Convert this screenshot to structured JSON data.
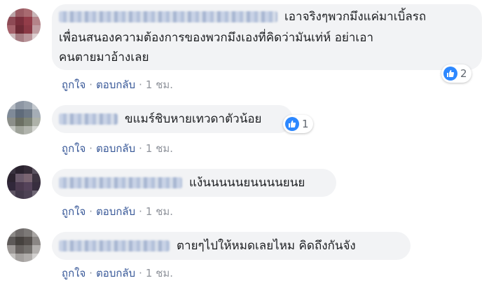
{
  "comments": [
    {
      "text_lines": [
        "เอาจริงๆพวกมึงแค่มาเบิ้ลรถ",
        "เพื่อนสนองความต้องการของพวกมึงเองที่คิดว่ามันเท่ห์ อย่าเอา",
        "คนตายมาอ้างเลย"
      ],
      "reaction_count": "2",
      "like_label": "ถูกใจ",
      "reply_label": "ตอบกลับ",
      "time": "1 ชม."
    },
    {
      "text_lines": [
        "ขแมร์ชิบหายเทวดาตัวน้อย"
      ],
      "reaction_count": "1",
      "like_label": "ถูกใจ",
      "reply_label": "ตอบกลับ",
      "time": "1 ชม."
    },
    {
      "text_lines": [
        "แง้นนนนนยนนนนยนย"
      ],
      "like_label": "ถูกใจ",
      "reply_label": "ตอบกลับ",
      "time": "1 ชม."
    },
    {
      "text_lines": [
        "ตายๆไปให้หมดเลยไหม คิดถึงกันจัง"
      ],
      "like_label": "ถูกใจ",
      "reply_label": "ตอบกลับ",
      "time": "1 ชม."
    }
  ],
  "separator": "·",
  "reaction_icon": "thumbs-up-icon",
  "colors": {
    "link": "#385898",
    "bubble": "#f2f3f5",
    "like_blue": "#2d88ff",
    "meta": "#90949c"
  }
}
